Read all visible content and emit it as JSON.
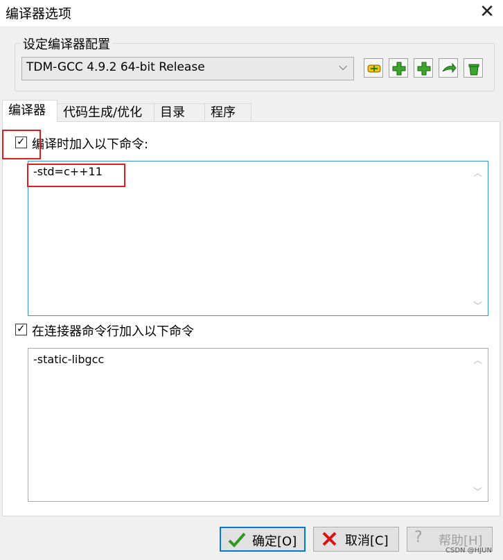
{
  "window": {
    "title": "编译器选项",
    "close_glyph": "✕"
  },
  "config_group": {
    "legend": "设定编译器配置",
    "selected_config": "TDM-GCC 4.9.2 64-bit Release",
    "toolbar_icons": [
      "rename-config-icon",
      "add-config-icon",
      "add-config-alt-icon",
      "export-config-icon",
      "delete-config-icon"
    ]
  },
  "tabs": [
    {
      "label": "编译器",
      "active": true
    },
    {
      "label": "代码生成/优化",
      "active": false
    },
    {
      "label": "目录",
      "active": false
    },
    {
      "label": "程序",
      "active": false
    }
  ],
  "compiler": {
    "compile_check_label": "编译时加入以下命令:",
    "compile_checked": true,
    "compile_commands": "-std=c++11",
    "linker_check_label": "在连接器命令行加入以下命令",
    "linker_checked": true,
    "linker_commands": "-static-libgcc"
  },
  "buttons": {
    "ok": "确定[O]",
    "cancel": "取消[C]",
    "help": "帮助[H]"
  },
  "watermark": "CSDN @HJUN",
  "colors": {
    "focus_border": "#3c8fd6",
    "highlight_red": "#e21b1b",
    "default_button_border": "#0078d7"
  }
}
